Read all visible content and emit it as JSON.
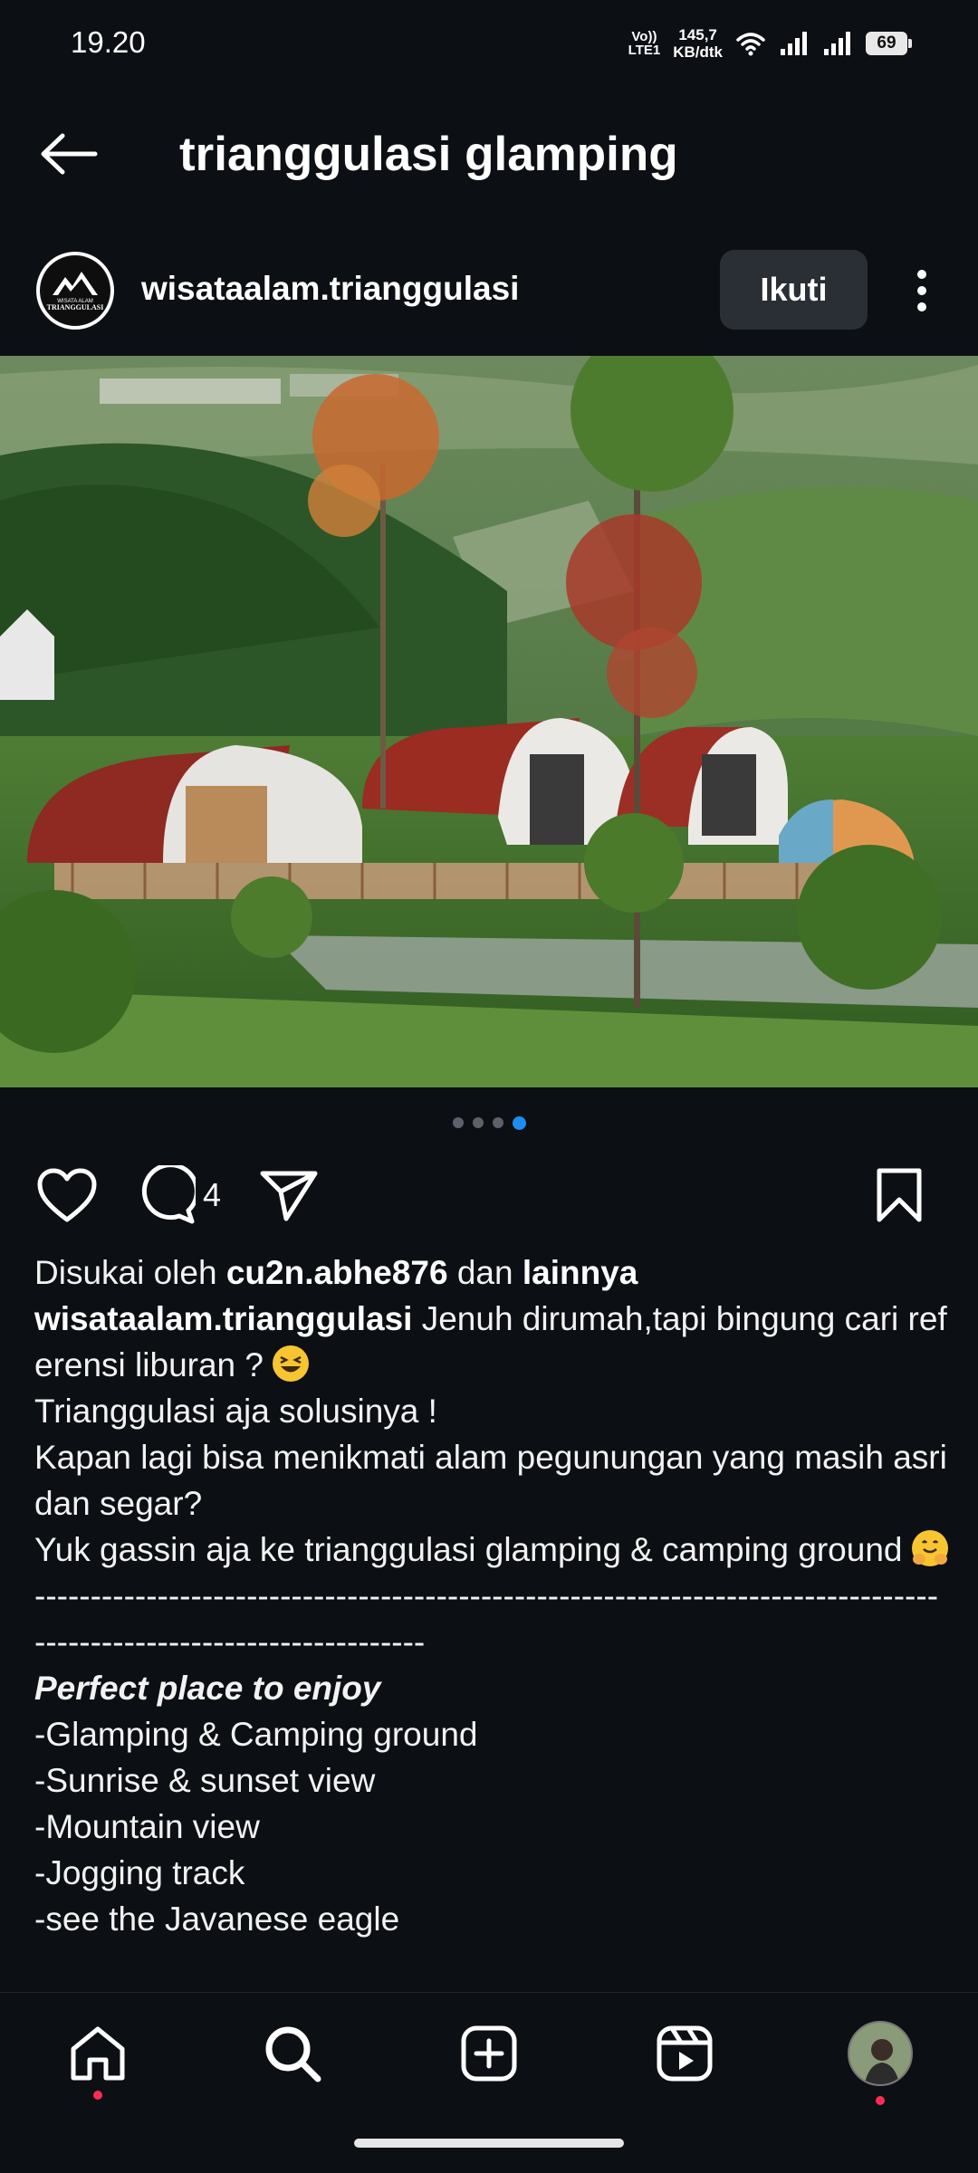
{
  "status_bar": {
    "time": "19.20",
    "volte_line1": "Vo))",
    "volte_line2": "LTE1",
    "speed_value": "145,7",
    "speed_unit": "KB/dtk",
    "battery": "69"
  },
  "header": {
    "title": "trianggulasi glamping"
  },
  "post": {
    "username": "wisataalam.trianggulasi",
    "follow_label": "Ikuti",
    "logo_line1": "WISATA ALAM",
    "logo_line2": "TRIANGGULASI",
    "carousel": {
      "total": 4,
      "active_index": 4
    },
    "comment_count": "4",
    "liked_by_prefix": "Disukai oleh ",
    "liked_by_user": "cu2n.abhe876",
    "liked_by_mid": " dan ",
    "liked_by_others": "lainnya",
    "caption_user": "wisataalam.trianggulasi",
    "caption_line1": " Jenuh dirumah,tapi bingung cari referensi liburan ? ",
    "caption_line2": "Trianggulasi aja solusinya !",
    "caption_line3": "Kapan lagi bisa menikmati alam pegunungan yang masih asri dan segar?",
    "caption_line4": "Yuk gassin aja ke trianggulasi glamping & camping ground ",
    "divider": "--------------------------------------------------------------------------------------------------------------------",
    "perfect_heading": "Perfect place to enjoy",
    "list": [
      "-Glamping & Camping ground",
      "-Sunrise & sunset view",
      "-Mountain view",
      "-Jogging track",
      "-see the Javanese eagle"
    ]
  },
  "colors": {
    "background": "#0c0f14",
    "accent_dot": "#1d8ef0",
    "notification_dot": "#ff2d55",
    "follow_button": "#2a2f36"
  },
  "icons": {
    "back": "arrow-left-icon",
    "more": "more-vertical-icon",
    "like": "heart-icon",
    "comment": "comment-bubble-icon",
    "share": "paper-plane-icon",
    "save": "bookmark-icon",
    "nav": [
      "home-icon",
      "search-icon",
      "create-plus-icon",
      "reels-icon",
      "profile-avatar"
    ]
  }
}
